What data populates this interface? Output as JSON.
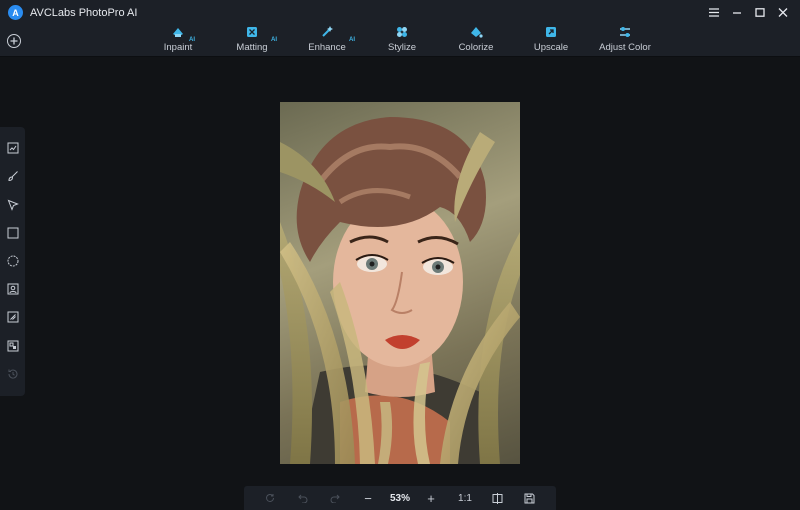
{
  "app": {
    "title": "AVCLabs PhotoPro AI",
    "logo_letter": "A"
  },
  "window_controls": [
    "menu-icon",
    "minimize-icon",
    "maximize-icon",
    "close-icon"
  ],
  "toolbar": {
    "tools": [
      {
        "label": "Inpaint",
        "ai": "AI",
        "icon": "inpaint-icon"
      },
      {
        "label": "Matting",
        "ai": "AI",
        "icon": "matting-icon"
      },
      {
        "label": "Enhance",
        "ai": "AI",
        "icon": "enhance-icon"
      },
      {
        "label": "Stylize",
        "ai": "",
        "icon": "stylize-icon"
      },
      {
        "label": "Colorize",
        "ai": "",
        "icon": "colorize-icon"
      },
      {
        "label": "Upscale",
        "ai": "",
        "icon": "upscale-icon"
      },
      {
        "label": "Adjust Color",
        "ai": "",
        "icon": "adjust-color-icon"
      }
    ],
    "accent": "#3fb6e8"
  },
  "sidebar": {
    "tools": [
      "auto-select-icon",
      "brush-icon",
      "lasso-icon",
      "rectangle-select-icon",
      "ellipse-select-icon",
      "portrait-select-icon",
      "object-select-icon",
      "layer-icon",
      "history-icon"
    ]
  },
  "bottombar": {
    "zoom": "53%",
    "minus": "−",
    "plus": "+",
    "actual_size": "1:1"
  }
}
